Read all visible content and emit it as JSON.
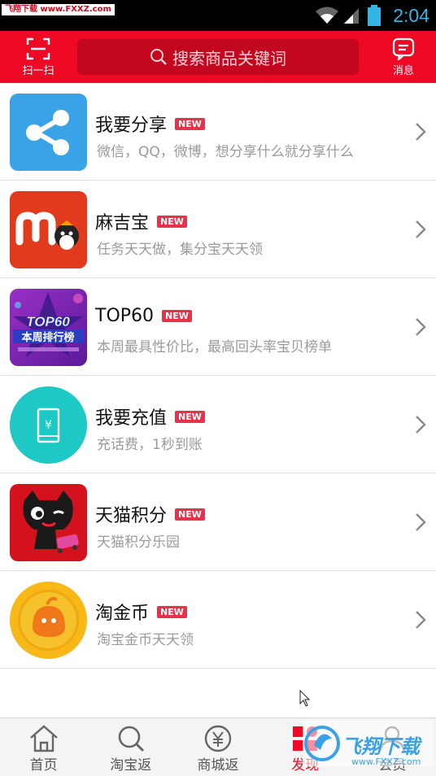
{
  "status_bar": {
    "watermark": "飞翔下载 www.FXXZ.com",
    "time": "2:04"
  },
  "header": {
    "scan_label": "扫一扫",
    "search_placeholder": "搜索商品关键词",
    "message_label": "消息"
  },
  "badge_text": "NEW",
  "items": [
    {
      "title": "我要分享",
      "desc": "微信，QQ，微博，想分享什么就分享什么",
      "icon": "share-icon"
    },
    {
      "title": "麻吉宝",
      "desc": "任务天天做，集分宝天天领",
      "icon": "majibao-logo"
    },
    {
      "title": "TOP60",
      "desc": "本周最具性价比，最高回头率宝贝榜单",
      "icon": "top60-banner",
      "thumb_text": "TOP60",
      "thumb_sub": "本周排行榜"
    },
    {
      "title": "我要充值",
      "desc": "充话费，1秒到账",
      "icon": "phone-recharge-icon",
      "thumb_text": "¥"
    },
    {
      "title": "天猫积分",
      "desc": "天猫积分乐园",
      "icon": "tmall-cat-icon"
    },
    {
      "title": "淘金币",
      "desc": "淘宝金币天天领",
      "icon": "taojinbi-coin-icon"
    }
  ],
  "tabs": [
    {
      "label": "首页",
      "icon": "home-icon"
    },
    {
      "label": "淘宝返",
      "icon": "search-icon"
    },
    {
      "label": "商城返",
      "icon": "yen-coin-icon"
    },
    {
      "label": "发现",
      "icon": "discover-icon",
      "active": true
    },
    {
      "label": "会员",
      "icon": "member-icon"
    }
  ],
  "watermark_logo": {
    "text": "飞翔下载",
    "url": "www.FXXZ.com"
  },
  "colors": {
    "brand_red": "#ee0a24",
    "badge_red": "#e8324a",
    "clock_blue": "#33b5e5"
  }
}
